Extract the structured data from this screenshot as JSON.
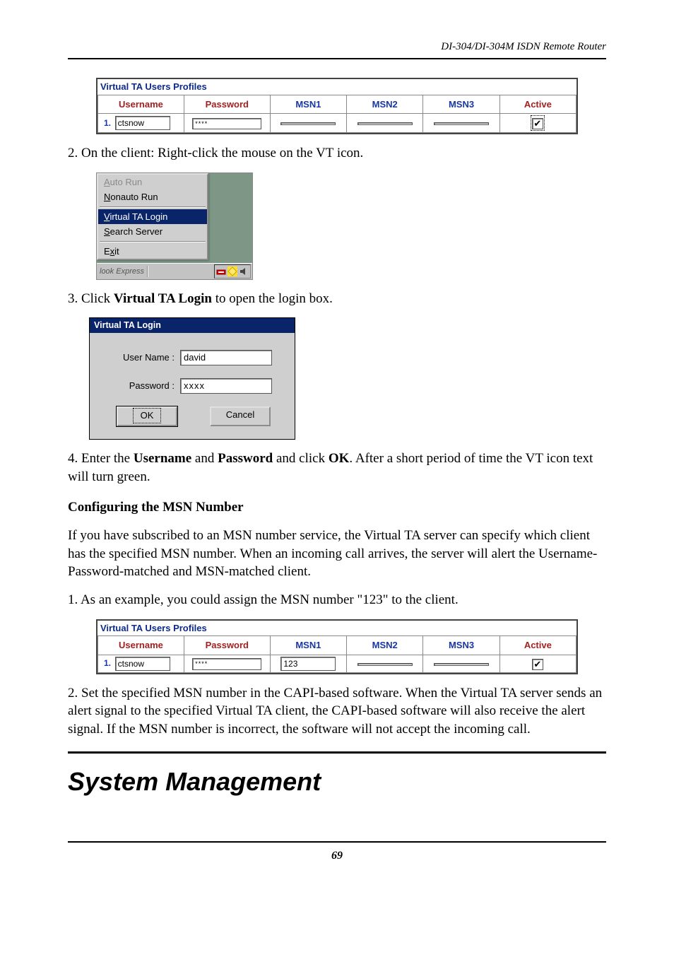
{
  "header": {
    "text": "DI-304/DI-304M ISDN Remote Router"
  },
  "footer": {
    "page": "69"
  },
  "profiles_table_1": {
    "caption": "Virtual TA Users Profiles",
    "columns": {
      "username": "Username",
      "password": "Password",
      "msn1": "MSN1",
      "msn2": "MSN2",
      "msn3": "MSN3",
      "active": "Active"
    },
    "row": {
      "index": "1.",
      "username": "ctsnow",
      "password": "****",
      "msn1": "",
      "msn2": "",
      "msn3": "",
      "active_checked": true,
      "active_focused": true
    }
  },
  "step2": {
    "text": "2. On the client: Right-click the mouse on the VT icon."
  },
  "context_menu": {
    "items": {
      "auto_run": "Auto Run",
      "nonauto_run": "Nonauto Run",
      "virtual_ta_login": "Virtual TA Login",
      "search_server": "Search Server",
      "exit": "Exit"
    },
    "taskbar_app": "look Express"
  },
  "step3": {
    "prefix": "3. Click ",
    "bold": "Virtual TA Login",
    "suffix": " to open the login box."
  },
  "login_dialog": {
    "title": "Virtual TA Login",
    "username_label": "User Name :",
    "password_label": "Password :",
    "username_value": "david",
    "password_value": "xxxx",
    "ok": "OK",
    "cancel": "Cancel"
  },
  "step4": {
    "prefix": "4. Enter the ",
    "b1": "Username",
    "mid1": " and ",
    "b2": "Password",
    "mid2": " and click ",
    "b3": "OK",
    "suffix": ". After a short period of time the VT icon text will turn green."
  },
  "msn_heading": "Configuring the MSN Number",
  "msn_para": "If you have subscribed to an MSN number service, the Virtual TA server can specify which client has the specified MSN number. When an incoming call arrives, the server will alert the Username-Password-matched and MSN-matched client.",
  "msn_step1": "1. As an example, you could assign the MSN number \"123\" to the client.",
  "profiles_table_2": {
    "caption": "Virtual TA Users Profiles",
    "columns": {
      "username": "Username",
      "password": "Password",
      "msn1": "MSN1",
      "msn2": "MSN2",
      "msn3": "MSN3",
      "active": "Active"
    },
    "row": {
      "index": "1.",
      "username": "ctsnow",
      "password": "****",
      "msn1": "123",
      "msn2": "",
      "msn3": "",
      "active_checked": true,
      "active_focused": false
    }
  },
  "msn_step2": "2. Set the specified MSN number in the CAPI-based software. When the Virtual TA server sends an alert signal to the specified Virtual TA client, the CAPI-based software will also receive the alert signal. If the MSN number is incorrect, the software will not accept the incoming call.",
  "big_title": "System Management"
}
